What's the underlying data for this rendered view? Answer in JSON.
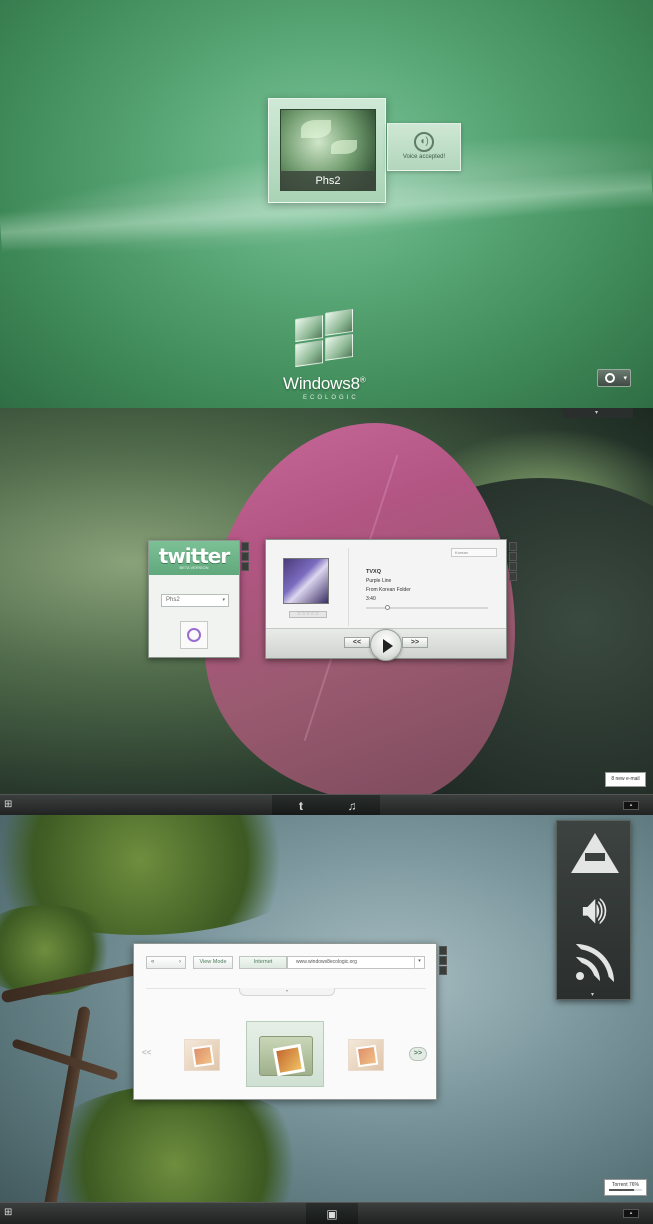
{
  "login": {
    "user_name": "Phs2",
    "voice_status": "Voice accepted!",
    "brand": "Windows8",
    "brand_mark": "®",
    "sub_brand": "ECOLOGIC"
  },
  "desktop1": {
    "twitter": {
      "logo": "twitter",
      "version": "BETA VERSION",
      "account": "Phs2"
    },
    "player": {
      "source": "Korean",
      "artist": "TVXQ",
      "title": "Purple Line",
      "folder": "From Korean Folder",
      "time": "3:40",
      "progress": 0.16,
      "prev_label": "<<",
      "next_label": ">>"
    },
    "notification": "8 new e-mail",
    "taskbar": {
      "start_glyph": "⊞",
      "twitter_glyph": "t",
      "music_glyph": "♫"
    }
  },
  "desktop2": {
    "browser": {
      "back_value": "«",
      "view_mode_label": "View Mode",
      "internet_label": "Internet",
      "url": "www.windows8ecologic.org",
      "nav_prev": "<<",
      "nav_next": ">>"
    },
    "notification": {
      "text": "Torrent 76%",
      "progress": 0.76
    },
    "taskbar": {
      "start_glyph": "⊞"
    }
  },
  "colors": {
    "login_green": "#5aa877",
    "accent_green": "#4b7d5c",
    "panel_dark": "#2a2f2d"
  }
}
